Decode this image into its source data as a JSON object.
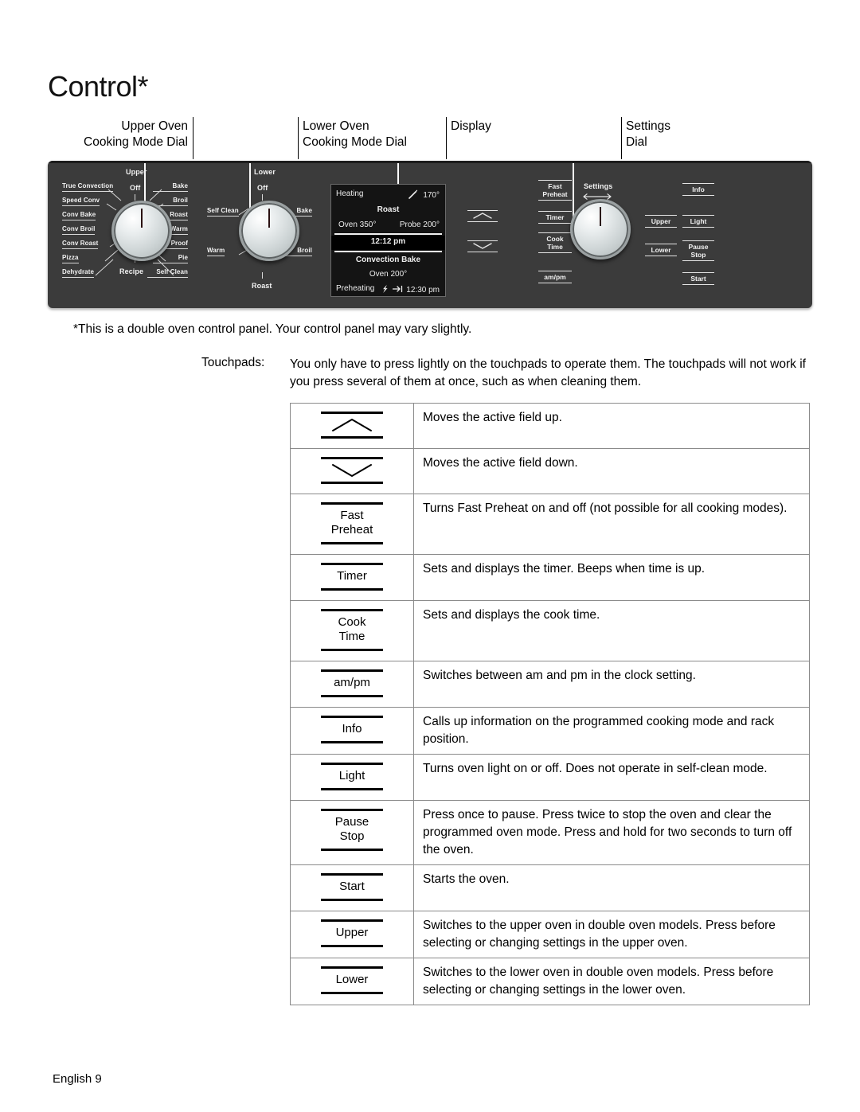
{
  "document": {
    "title": "Control*",
    "footnote": "*This is a double oven control panel. Your control panel may vary slightly.",
    "footer": "English 9"
  },
  "callouts": [
    {
      "line1": "Upper Oven",
      "line2": "Cooking Mode Dial"
    },
    {
      "line1": "Lower Oven",
      "line2": "Cooking Mode Dial"
    },
    {
      "line1": "Display",
      "line2": ""
    },
    {
      "line1": "Settings",
      "line2": "Dial"
    }
  ],
  "panel": {
    "upper_dial": {
      "name": "Upper",
      "off": "Off",
      "bottom": "Recipe",
      "left_modes": [
        "True Convection",
        "Speed Conv",
        "Conv Bake",
        "Conv Broil",
        "Conv Roast",
        "Pizza",
        "Dehydrate"
      ],
      "right_modes": [
        "Bake",
        "Broil",
        "Roast",
        "Warm",
        "Proof",
        "Pie",
        "Self Clean"
      ]
    },
    "lower_dial": {
      "name": "Lower",
      "off": "Off",
      "bottom": "Roast",
      "left_modes": [
        "Self Clean",
        "Warm"
      ],
      "right_modes": [
        "Bake",
        "Broil"
      ]
    },
    "settings_dial": {
      "name": "Settings",
      "arrow": "icon-double-arrow"
    },
    "display": {
      "status_left": "Heating",
      "probe_icon": "probe-icon",
      "probe_temp": "170°",
      "mode_upper": "Roast",
      "oven_upper": "Oven 350°",
      "probe_upper": "Probe 200°",
      "clock": "12:12 pm",
      "mode_lower": "Convection Bake",
      "oven_lower": "Oven 200°",
      "status_lower": "Preheating",
      "bolt_icon": "bolt-icon",
      "arrow_icon": "arrow-to-bar-icon",
      "end_time": "12:30 pm"
    },
    "keys_center": [
      "Fast\nPreheat",
      "Timer",
      "Cook\nTime",
      "am/pm"
    ],
    "keys_center_lines": [
      [
        "Fast",
        "Preheat"
      ],
      [
        "Timer"
      ],
      [
        "Cook",
        "Time"
      ],
      [
        "am/pm"
      ]
    ],
    "keys_arrows": [
      {
        "label": "up-chevron-icon"
      },
      {
        "label": "down-chevron-icon"
      }
    ],
    "keys_right_col1": [
      "Upper",
      "Lower"
    ],
    "keys_right_col2": [
      "Info",
      "Light",
      "Pause\nStop",
      "Start"
    ],
    "keys_right_col2_lines": [
      [
        "Info"
      ],
      [
        "Light"
      ],
      [
        "Pause",
        "Stop"
      ],
      [
        "Start"
      ]
    ]
  },
  "touchpads": {
    "label": "Touchpads:",
    "text": "You only have to press lightly on the touchpads to operate them. The touchpads will not work if you press several of them at once, such as when cleaning them."
  },
  "table": {
    "rows": [
      {
        "icon": "up-chevron-icon",
        "pad_lines": [],
        "description": "Moves the active field up."
      },
      {
        "icon": "down-chevron-icon",
        "pad_lines": [],
        "description": "Moves the active field down."
      },
      {
        "icon": null,
        "pad_lines": [
          "Fast",
          "Preheat"
        ],
        "description": "Turns Fast Preheat on and off (not possible for all cooking modes)."
      },
      {
        "icon": null,
        "pad_lines": [
          "Timer"
        ],
        "description": "Sets and displays the timer. Beeps when time is up."
      },
      {
        "icon": null,
        "pad_lines": [
          "Cook",
          "Time"
        ],
        "description": "Sets and displays the cook time."
      },
      {
        "icon": null,
        "pad_lines": [
          "am/pm"
        ],
        "description": "Switches between am and pm in the clock setting."
      },
      {
        "icon": null,
        "pad_lines": [
          "Info"
        ],
        "description": "Calls up information on the programmed cooking mode and rack position."
      },
      {
        "icon": null,
        "pad_lines": [
          "Light"
        ],
        "description": "Turns oven light on or off. Does not operate in self-clean mode."
      },
      {
        "icon": null,
        "pad_lines": [
          "Pause",
          "Stop"
        ],
        "description": "Press once to pause. Press twice to stop the oven and clear the programmed oven mode. Press and hold for two seconds to turn off the oven."
      },
      {
        "icon": null,
        "pad_lines": [
          "Start"
        ],
        "description": "Starts the oven."
      },
      {
        "icon": null,
        "pad_lines": [
          "Upper"
        ],
        "description": "Switches to the upper oven in double oven models. Press before selecting or changing settings in the upper oven."
      },
      {
        "icon": null,
        "pad_lines": [
          "Lower"
        ],
        "description": "Switches to the lower oven in double oven models. Press before selecting or changing settings in the lower oven."
      }
    ]
  },
  "colors": {
    "panel_bg": "#3b3b3b",
    "screen_bg": "#141414",
    "text": "#000000",
    "panel_text": "#f2f2f2"
  }
}
